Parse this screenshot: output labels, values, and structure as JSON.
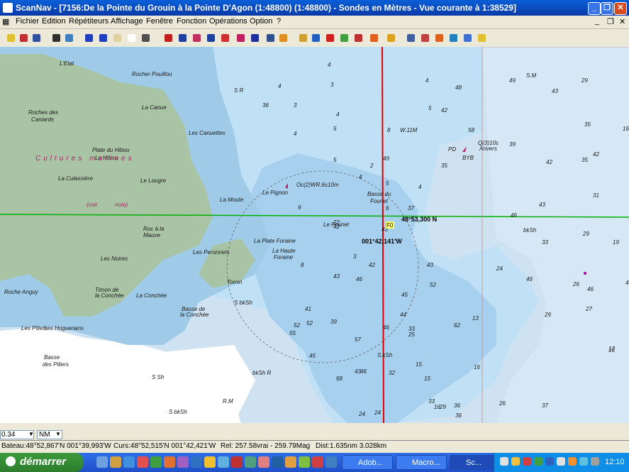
{
  "window": {
    "title": "ScanNav - [7156:De la Pointe du Grouin à la Pointe D'Agon (1:48800) (1:48800) - Sondes en  Mètres  - Vue courante à 1:38529]",
    "buttons": [
      "_",
      "❐",
      "✕"
    ]
  },
  "menu": [
    "Fichier",
    "Edition",
    "Répétiteurs",
    "Affichage",
    "Fenêtre",
    "Fonction",
    "Opérations",
    "Option",
    "?"
  ],
  "toolbar_icons": [
    "new-chart-icon",
    "open-icon",
    "save-icon",
    "print-icon",
    "help-pointer-icon",
    "zoom-in-icon",
    "zoom-out-icon",
    "pan-hand-icon",
    "select-rect-icon",
    "select-arrow-icon",
    "anchor-icon",
    "waypoint-icon",
    "route-icon",
    "track-icon",
    "mark-icon",
    "erase-icon",
    "text-A-icon",
    "layers-icon",
    "bearing-icon",
    "tide-icon",
    "compass-icon",
    "target-icon",
    "route-edit-icon",
    "lighthouse-icon",
    "lifebuoy-icon",
    "chart-list-icon",
    "grid-icon",
    "boat-icon",
    "boat-track-icon",
    "wind-icon",
    "current-icon",
    "stats-icon"
  ],
  "chart": {
    "labels": [
      {
        "text": "Rocher Pouillou"
      },
      {
        "text": "Roches des"
      },
      {
        "text": "Caniards"
      },
      {
        "text": "La Canue"
      },
      {
        "text": "Les Canuettes"
      },
      {
        "text": "Plate du Hibou"
      },
      {
        "text": "Le Hibou"
      },
      {
        "text": "Cultures marines"
      },
      {
        "text": "La Culassière"
      },
      {
        "text": "Le Lougre"
      },
      {
        "text": "La Moute"
      },
      {
        "text": "Le Pignon"
      },
      {
        "text": "Oc(2)WR.6s10m"
      },
      {
        "text": "Basse du"
      },
      {
        "text": "Founet"
      },
      {
        "text": "Le Founet"
      },
      {
        "text": "Roc à la"
      },
      {
        "text": "Mauve"
      },
      {
        "text": "Les Noires"
      },
      {
        "text": "Les Peronnets"
      },
      {
        "text": "La Plate Foraine"
      },
      {
        "text": "La Haute"
      },
      {
        "text": "Foraine"
      },
      {
        "text": "Tomin"
      },
      {
        "text": "Timon de"
      },
      {
        "text": "la Conchée"
      },
      {
        "text": "La Conchée"
      },
      {
        "text": "Basse de"
      },
      {
        "text": "la Conchée"
      },
      {
        "text": "Roche Anguy"
      },
      {
        "text": "Les Piliers"
      },
      {
        "text": "Les Huguenans"
      },
      {
        "text": "Basse"
      },
      {
        "text": "des Piliers"
      },
      {
        "text": "Q(3)10s"
      },
      {
        "text": "Anvers"
      },
      {
        "text": "BYB"
      },
      {
        "text": "PD"
      },
      {
        "text": "S bkSh"
      },
      {
        "text": "S.kSh"
      },
      {
        "text": "bkSh R"
      },
      {
        "text": "R.M"
      },
      {
        "text": "S Sh"
      },
      {
        "text": "S bkSh"
      },
      {
        "text": "bkSh"
      },
      {
        "text": "S.M"
      },
      {
        "text": "S R"
      },
      {
        "text": "W.11M"
      },
      {
        "text": "(voir"
      },
      {
        "text": "nota)"
      },
      {
        "text": "L'Etat"
      }
    ],
    "soundings": [
      "4",
      "4",
      "36",
      "3",
      "3",
      "4",
      "5",
      "4",
      "8",
      "5",
      "5",
      "4",
      "6",
      "9",
      "2",
      "4",
      "3",
      "8",
      "29",
      "43",
      "35",
      "16",
      "35",
      "42",
      "31",
      "29",
      "19",
      "26",
      "27",
      "16",
      "24",
      "25",
      "46",
      "15",
      "15",
      "32",
      "36",
      "24",
      "29",
      "37",
      "41",
      "52",
      "45",
      "33",
      "16",
      "13",
      "16",
      "26",
      "24",
      "42",
      "5",
      "4",
      "39",
      "58",
      "49",
      "46",
      "48",
      "49",
      "35",
      "37",
      "46",
      "33",
      "17",
      "43",
      "43",
      "29",
      "52",
      "42",
      "43",
      "42",
      "43",
      "39",
      "46",
      "45",
      "62",
      "57",
      "68",
      "52",
      "46",
      "55",
      "44",
      "33",
      "22",
      "42",
      "43",
      "36",
      "46",
      "48"
    ],
    "cursor_lat": "48°53,300 N",
    "cursor_lon": "001°42,141'W",
    "cursor_tag": "F0"
  },
  "lower_controls": {
    "scale_value": "0.34",
    "unit": "NM"
  },
  "status": {
    "boat": "Bateau:48°52,867'N 001°39,993'W",
    "cursor": "Curs:48°52,515'N 001°42,421'W",
    "bearing": "Rel: 257.58vrai - 259.79Mag",
    "dist": "Dist:1.635nm  3.028km"
  },
  "taskbar": {
    "start": "démarrer",
    "tasks": [
      "Adob...",
      "Macro...",
      "Sc..."
    ],
    "time": "12:10"
  },
  "colors": {
    "land": "#a9c4a4",
    "shallow": "#a6d0ee",
    "deep": "#cfe6f6",
    "sea_open": "#cfe2f2",
    "white_sea": "#ffffff",
    "red_line": "#e00000",
    "green_line": "#00b000",
    "title_blue": "#0a4ac8",
    "taskbar_blue": "#245edb",
    "start_green": "#3a9a3a"
  }
}
